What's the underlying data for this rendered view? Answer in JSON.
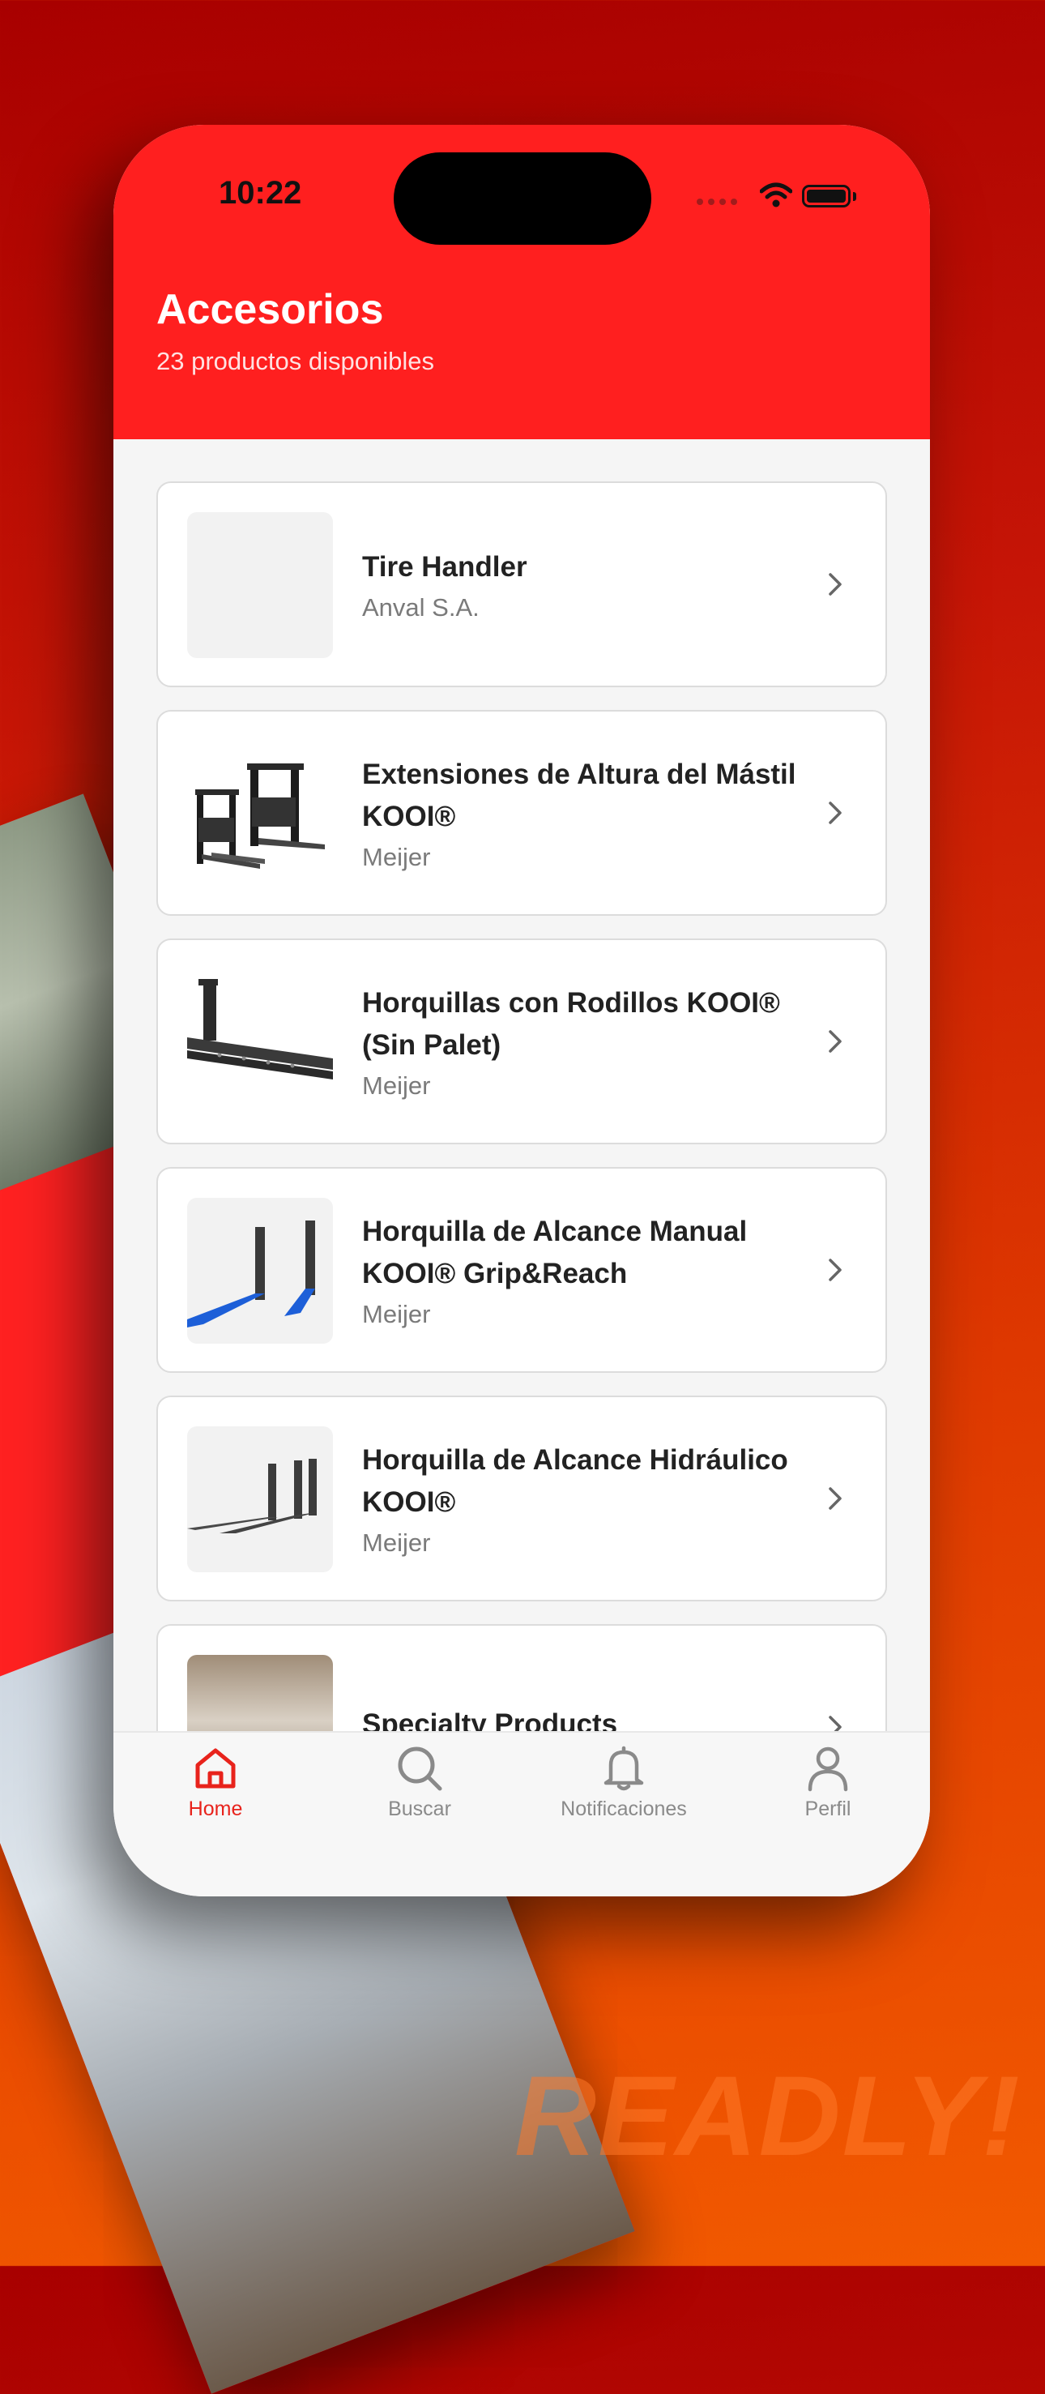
{
  "status_bar": {
    "time": "10:22"
  },
  "header": {
    "title": "Accesorios",
    "subtitle": "23 productos disponibles"
  },
  "products": [
    {
      "name": "Tire Handler",
      "brand": "Anval S.A.",
      "thumb_icon": "placeholder-image"
    },
    {
      "name": "Extensiones de Altura del Mástil KOOI®",
      "brand": "Meijer",
      "thumb_icon": "mast-extension-image"
    },
    {
      "name": "Horquillas con Rodillos KOOI® (Sin Palet)",
      "brand": "Meijer",
      "thumb_icon": "roller-forks-image"
    },
    {
      "name": "Horquilla de Alcance Manual KOOI® Grip&Reach",
      "brand": "Meijer",
      "thumb_icon": "blue-forks-image"
    },
    {
      "name": "Horquilla de Alcance Hidráulico KOOI®",
      "brand": "Meijer",
      "thumb_icon": "hydraulic-forks-image"
    },
    {
      "name": "Specialty Products",
      "brand": "",
      "thumb_icon": "warehouse-photo"
    }
  ],
  "tabs": [
    {
      "label": "Home",
      "icon": "home-icon",
      "active": true
    },
    {
      "label": "Buscar",
      "icon": "search-icon",
      "active": false
    },
    {
      "label": "Notificaciones",
      "icon": "bell-icon",
      "active": false
    },
    {
      "label": "Perfil",
      "icon": "user-icon",
      "active": false
    }
  ],
  "watermark": "READLY!",
  "colors": {
    "brand_red": "#ff1f1f",
    "active_tab": "#e8231c",
    "inactive_tab": "#8a8a8a",
    "background_gradient_end": "#f25a00"
  }
}
